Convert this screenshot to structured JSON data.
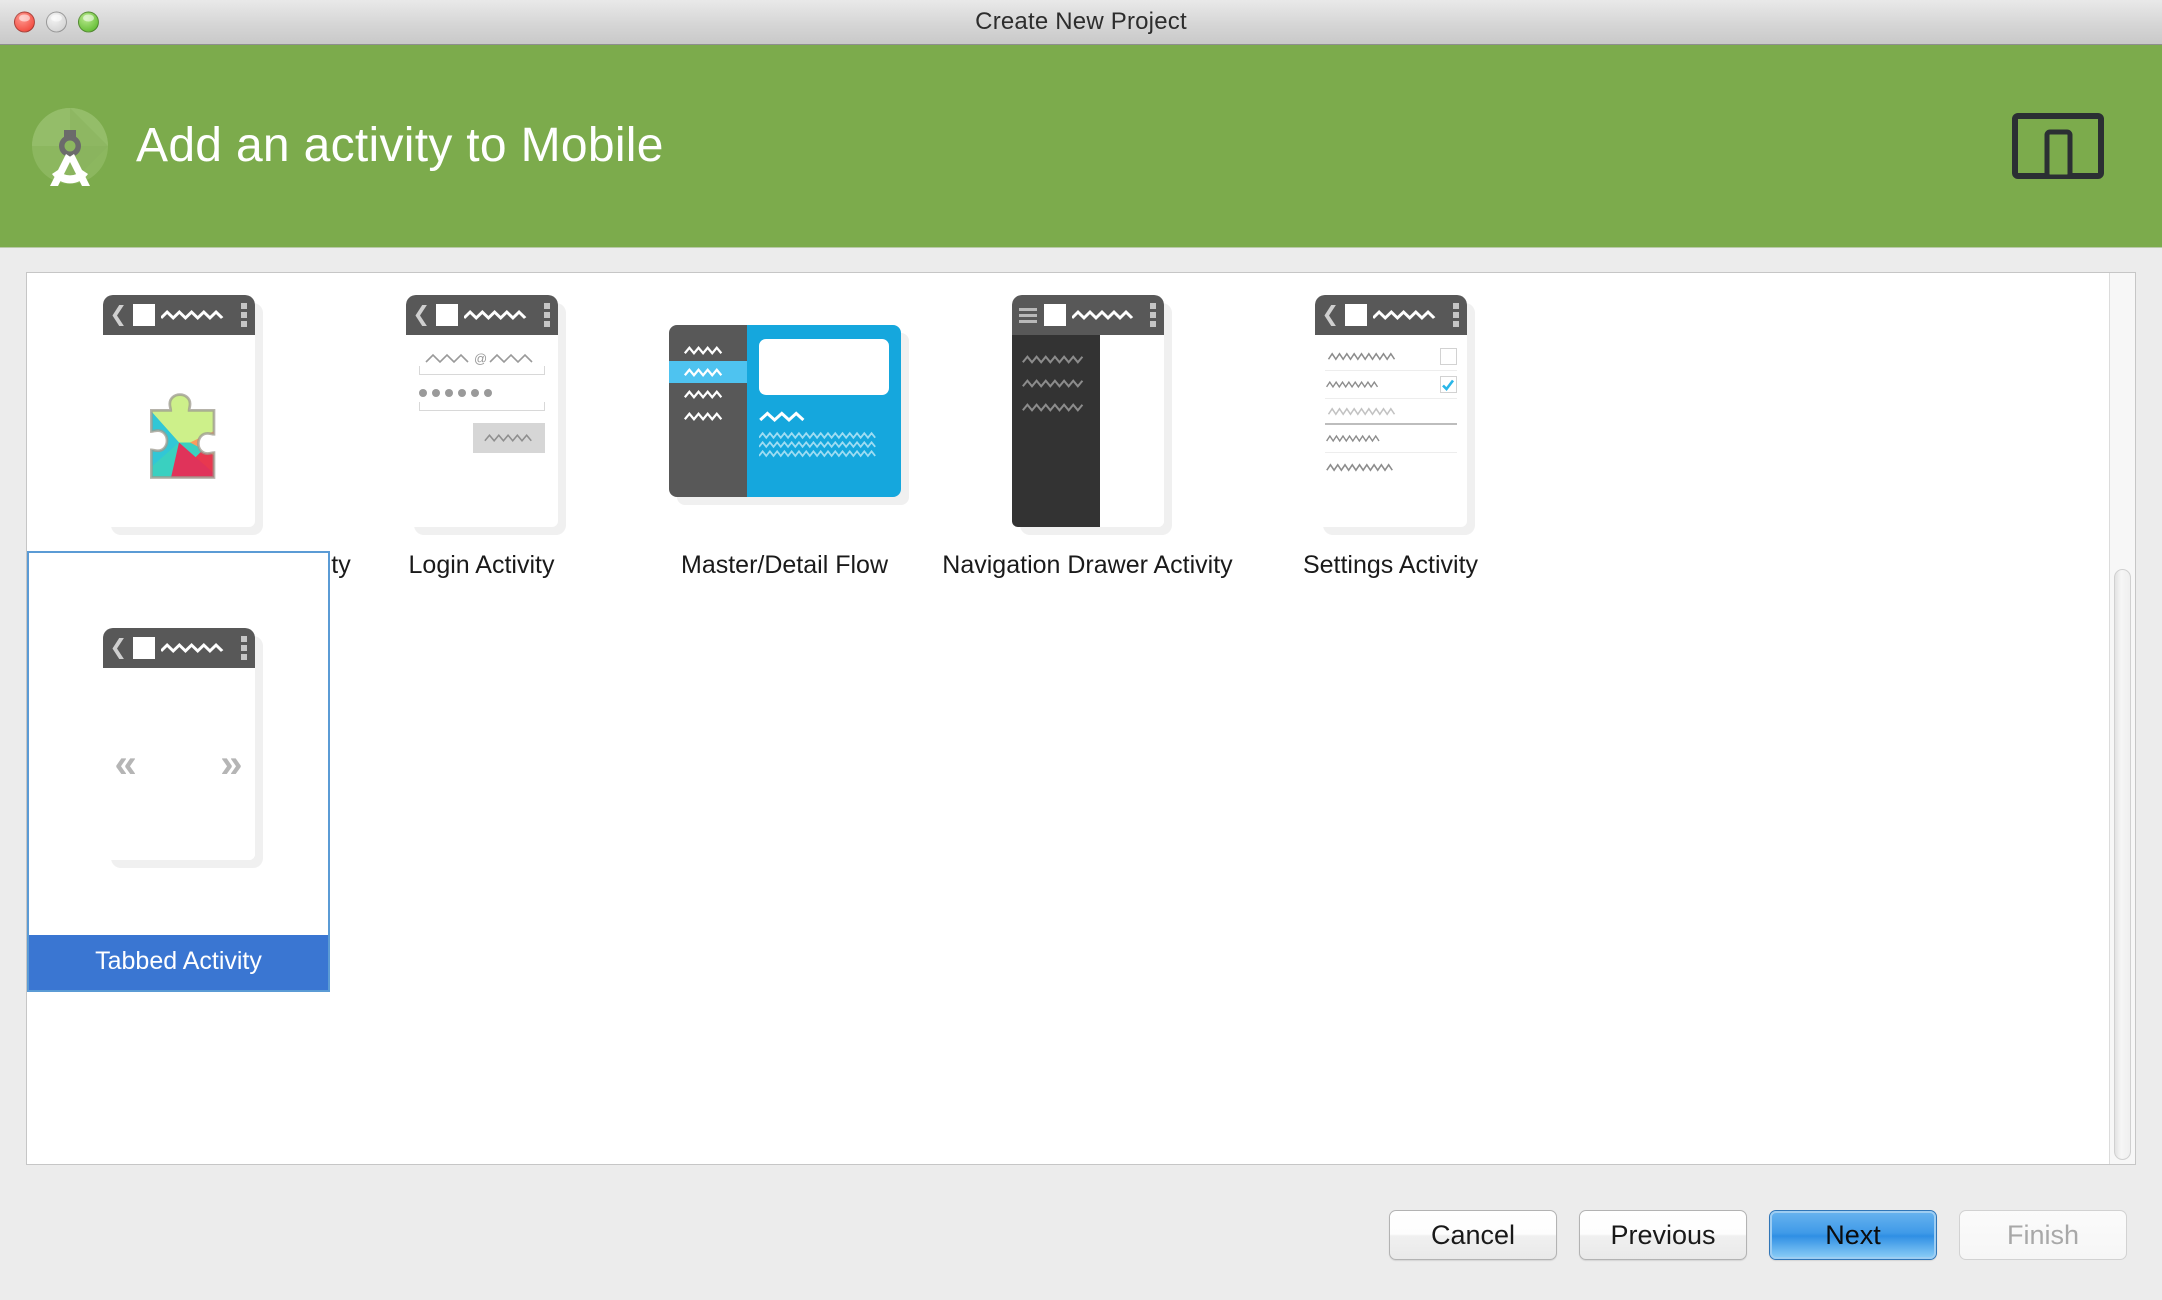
{
  "window": {
    "title": "Create New Project",
    "traffic_lights": [
      "close",
      "minimize",
      "zoom"
    ]
  },
  "header": {
    "title": "Add an activity to Mobile",
    "logo_icon": "android-studio-compass-icon",
    "device_icon": "tablet-and-phone-icon",
    "background_color": "#7cab4c"
  },
  "templates": {
    "selected": "Tabbed Activity",
    "items": [
      {
        "label": "Google Play Services Activity",
        "thumb": "play-services",
        "selected": false
      },
      {
        "label": "Login Activity",
        "thumb": "login",
        "selected": false
      },
      {
        "label": "Master/Detail Flow",
        "thumb": "master-detail",
        "selected": false
      },
      {
        "label": "Navigation Drawer Activity",
        "thumb": "nav-drawer",
        "selected": false
      },
      {
        "label": "Settings Activity",
        "thumb": "settings",
        "selected": false
      },
      {
        "label": "Tabbed Activity",
        "thumb": "tabbed",
        "selected": true
      }
    ]
  },
  "scrollbar": {
    "orientation": "vertical",
    "thumb_position_percent": 55
  },
  "buttons": {
    "cancel": {
      "label": "Cancel",
      "state": "enabled"
    },
    "previous": {
      "label": "Previous",
      "state": "enabled"
    },
    "next": {
      "label": "Next",
      "state": "default"
    },
    "finish": {
      "label": "Finish",
      "state": "disabled"
    }
  },
  "colors": {
    "header_green": "#7cab4c",
    "selection_blue": "#3a76d2",
    "selection_border": "#5b9bd5",
    "accent_cyan": "#15a7dd",
    "appbar_gray": "#585858",
    "drawer_dark": "#333333"
  }
}
